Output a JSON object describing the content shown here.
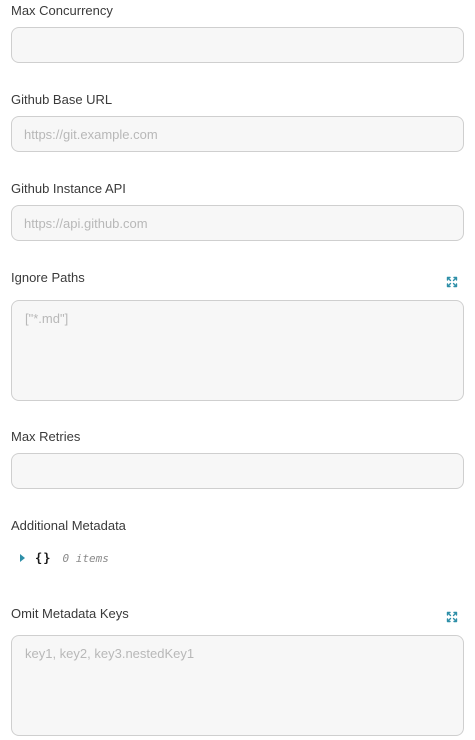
{
  "form": {
    "max_concurrency": {
      "label": "Max Concurrency",
      "value": "",
      "placeholder": ""
    },
    "github_base_url": {
      "label": "Github Base URL",
      "value": "",
      "placeholder": "https://git.example.com"
    },
    "github_instance_api": {
      "label": "Github Instance API",
      "value": "",
      "placeholder": "https://api.github.com"
    },
    "ignore_paths": {
      "label": "Ignore Paths",
      "value": "",
      "placeholder": "[\"*.md\"]",
      "icon": "expand-icon"
    },
    "max_retries": {
      "label": "Max Retries",
      "value": "",
      "placeholder": ""
    },
    "additional_metadata": {
      "label": "Additional Metadata",
      "braces": "{}",
      "count_text": "0 items"
    },
    "omit_metadata_keys": {
      "label": "Omit Metadata Keys",
      "value": "",
      "placeholder": "key1, key2, key3.nestedKey1",
      "icon": "expand-icon"
    }
  },
  "colors": {
    "accent": "#2e8fa8",
    "field_border": "#cfcfcf",
    "field_background": "#f7f7f7",
    "placeholder": "#b8b8b8"
  }
}
